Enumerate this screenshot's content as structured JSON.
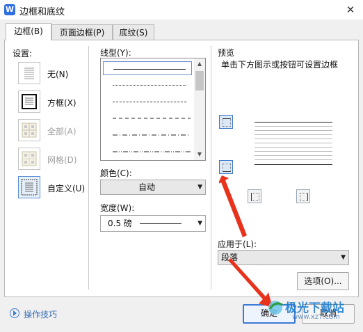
{
  "window": {
    "title": "边框和底纹",
    "app_icon_letter": "W",
    "close_symbol": "✕"
  },
  "tabs": [
    {
      "label": "边框(B)",
      "active": true
    },
    {
      "label": "页面边框(P)",
      "active": false
    },
    {
      "label": "底纹(S)",
      "active": false
    }
  ],
  "settings": {
    "label": "设置:",
    "items": [
      {
        "label": "无(N)",
        "enabled": true,
        "selected": false
      },
      {
        "label": "方框(X)",
        "enabled": true,
        "selected": false
      },
      {
        "label": "全部(A)",
        "enabled": false,
        "selected": false
      },
      {
        "label": "网格(D)",
        "enabled": false,
        "selected": false
      },
      {
        "label": "自定义(U)",
        "enabled": true,
        "selected": true
      }
    ]
  },
  "line_style": {
    "label": "线型(Y):"
  },
  "color": {
    "label": "颜色(C):",
    "value": "自动"
  },
  "width": {
    "label": "宽度(W):",
    "value": "0.5  磅"
  },
  "preview": {
    "label": "预览",
    "hint": "单击下方图示或按钮可设置边框"
  },
  "apply_to": {
    "label": "应用于(L):",
    "value": "段落"
  },
  "buttons": {
    "options": "选项(O)...",
    "ok": "确定",
    "cancel": "取消"
  },
  "tips": {
    "label": "操作技巧"
  },
  "watermark": {
    "text": "极光下载站",
    "url": "www.xz7.com"
  },
  "colors": {
    "accent": "#3c7ad6",
    "arrow": "#e8321c",
    "app_icon": "#2f6fe3"
  }
}
